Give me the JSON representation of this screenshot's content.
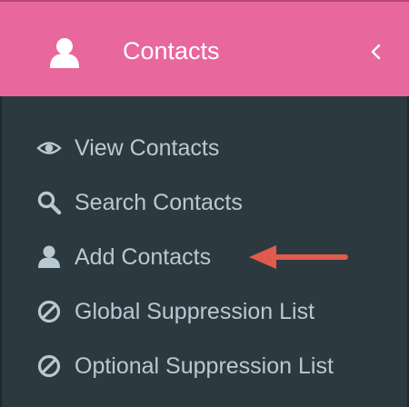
{
  "header": {
    "title": "Contacts",
    "user_icon": "user-icon",
    "collapse_icon": "chevron-left-icon"
  },
  "menu": {
    "items": [
      {
        "label": "View Contacts",
        "icon": "eye-icon"
      },
      {
        "label": "Search Contacts",
        "icon": "search-icon"
      },
      {
        "label": "Add Contacts",
        "icon": "user-icon"
      },
      {
        "label": "Global Suppression List",
        "icon": "ban-icon"
      },
      {
        "label": "Optional Suppression List",
        "icon": "ban-icon"
      }
    ]
  },
  "annotation": {
    "icon": "arrow-left-icon"
  },
  "colors": {
    "header_bg": "#e8689d",
    "sidebar_bg": "#2c3a40",
    "menu_text": "#b9c9d3",
    "arrow": "#e05a4e"
  }
}
